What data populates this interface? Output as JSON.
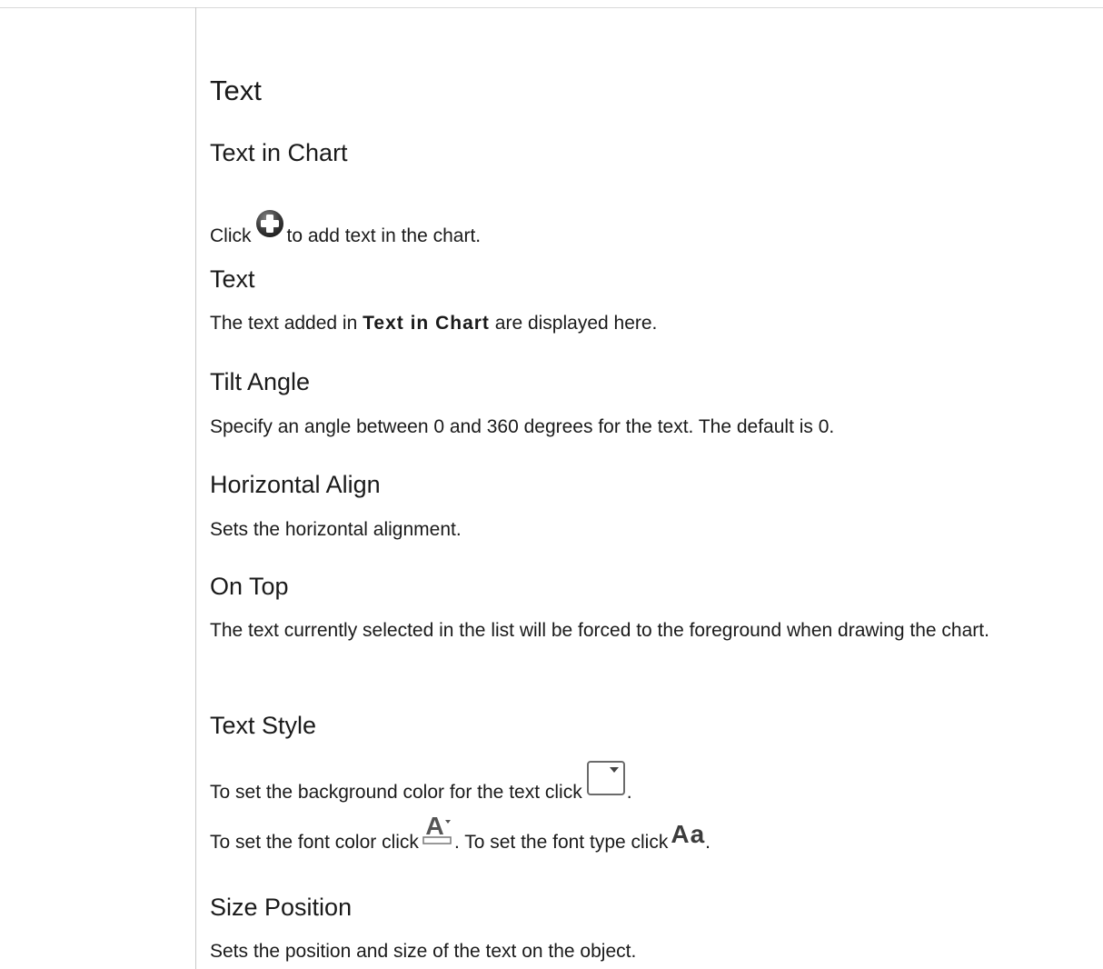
{
  "page": {
    "title": "Text"
  },
  "icons": {
    "add": "plus-circle-icon",
    "background_color": "dropdown-box-icon",
    "font_color": "font-color-icon",
    "font_type": "font-type-icon",
    "font_type_glyph": "Aa"
  },
  "sections": {
    "text_in_chart": {
      "title": "Text in Chart",
      "before_icon": "Click",
      "after_icon": "to add text in the chart."
    },
    "text": {
      "title": "Text",
      "before_term": "The text added in",
      "term": "Text in Chart",
      "after_term": "are displayed here."
    },
    "tilt_angle": {
      "title": "Tilt Angle",
      "body": "Specify an angle between 0 and 360 degrees for the text. The default is 0."
    },
    "horizontal_align": {
      "title": "Horizontal Align",
      "body": "Sets the horizontal alignment."
    },
    "on_top": {
      "title": "On Top",
      "body": "The text currently selected in the list will be forced to the foreground when drawing the chart."
    },
    "text_style": {
      "title": "Text Style",
      "bg_before": "To set the background color for the text click",
      "bg_after": ".",
      "font_color_before": "To set the font color click",
      "font_color_after": ". To set the font type click",
      "font_type_after": "."
    },
    "size_position": {
      "title": "Size Position",
      "body": "Sets the position and size of the text on the object."
    }
  }
}
